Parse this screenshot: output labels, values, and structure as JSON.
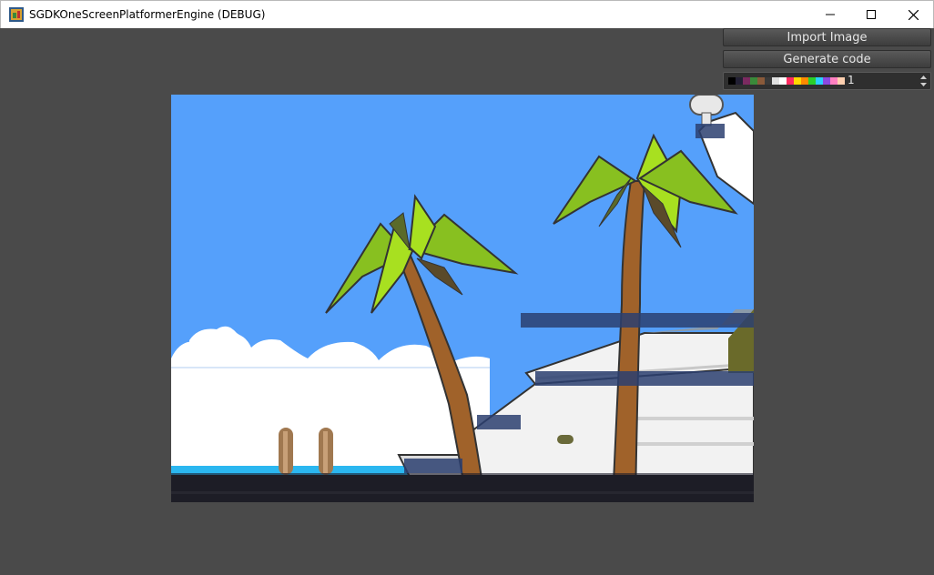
{
  "window": {
    "title": "SGDKOneScreenPlatformerEngine (DEBUG)"
  },
  "toolbar": {
    "import_label": "Import Image",
    "generate_label": "Generate code"
  },
  "palette": {
    "selected_value": "1",
    "swatch_colors": [
      "#000000",
      "#222034",
      "#7b2a60",
      "#3a8a3a",
      "#8a5a3a",
      "#3a3a3a",
      "#e0e0e0",
      "#ffffff",
      "#ff2a60",
      "#ffd800",
      "#ff8a00",
      "#2ad02a",
      "#2ad0ff",
      "#8a4ae0",
      "#ff80c0",
      "#ffd0b0"
    ]
  },
  "colors": {
    "sky": "#55a0fb",
    "collision_overlay": "#2b3f70"
  }
}
